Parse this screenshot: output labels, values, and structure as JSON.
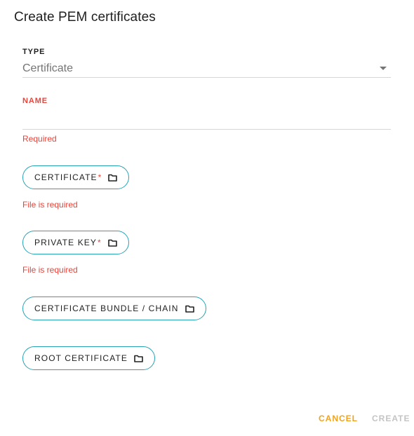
{
  "dialog": {
    "title": "Create PEM certificates"
  },
  "type_field": {
    "label": "TYPE",
    "value": "Certificate"
  },
  "name_field": {
    "label": "NAME",
    "value": "",
    "error": "Required"
  },
  "certificate_button": {
    "label": "CERTIFICATE",
    "required_marker": "*",
    "error": "File is required"
  },
  "private_key_button": {
    "label": "PRIVATE KEY",
    "required_marker": "*",
    "error": "File is required"
  },
  "bundle_button": {
    "label": "CERTIFICATE BUNDLE / CHAIN"
  },
  "root_button": {
    "label": "ROOT CERTIFICATE"
  },
  "actions": {
    "cancel": "CANCEL",
    "create": "CREATE"
  },
  "colors": {
    "accent_border": "#26a3b5",
    "error": "#e8443a",
    "cancel": "#f2a31c",
    "disabled": "#c4c4c4"
  },
  "icons": {
    "file_picker": "folder-icon",
    "dropdown": "caret-down-icon"
  }
}
